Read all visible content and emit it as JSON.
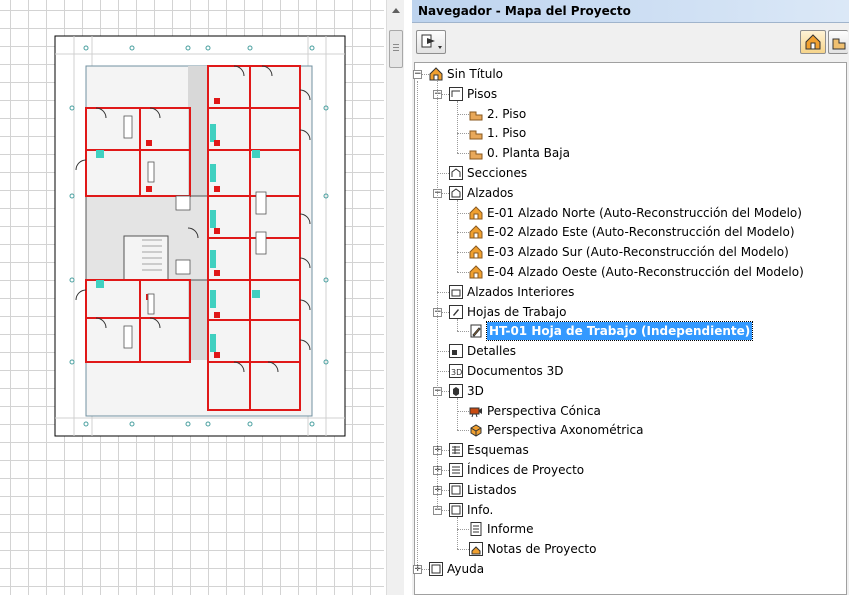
{
  "navigator": {
    "title": "Navegador - Mapa del Proyecto"
  },
  "tree": [
    {
      "id": "root",
      "label": "Sin Título",
      "level": 0,
      "expander": "-",
      "icon": "house-icon"
    },
    {
      "id": "pisos",
      "label": "Pisos",
      "level": 1,
      "expander": "-",
      "icon": "stories-icon"
    },
    {
      "id": "piso2",
      "label": "2. Piso",
      "level": 2,
      "icon": "story-icon"
    },
    {
      "id": "piso1",
      "label": "1. Piso",
      "level": 2,
      "icon": "story-icon"
    },
    {
      "id": "piso0",
      "label": "0. Planta Baja",
      "level": 2,
      "icon": "story-icon"
    },
    {
      "id": "secciones",
      "label": "Secciones",
      "level": 1,
      "icon": "section-icon"
    },
    {
      "id": "alzados",
      "label": "Alzados",
      "level": 1,
      "expander": "-",
      "icon": "elevation-icon"
    },
    {
      "id": "e01",
      "label": "E-01 Alzado Norte (Auto-Reconstrucción del Modelo)",
      "level": 2,
      "icon": "elevation-item-icon"
    },
    {
      "id": "e02",
      "label": "E-02 Alzado Este (Auto-Reconstrucción del Modelo)",
      "level": 2,
      "icon": "elevation-item-icon"
    },
    {
      "id": "e03",
      "label": "E-03 Alzado Sur (Auto-Reconstrucción del Modelo)",
      "level": 2,
      "icon": "elevation-item-icon"
    },
    {
      "id": "e04",
      "label": "E-04 Alzado Oeste (Auto-Reconstrucción del Modelo)",
      "level": 2,
      "icon": "elevation-item-icon"
    },
    {
      "id": "alzint",
      "label": "Alzados Interiores",
      "level": 1,
      "icon": "interior-elevation-icon"
    },
    {
      "id": "hojas",
      "label": "Hojas de Trabajo",
      "level": 1,
      "expander": "-",
      "icon": "worksheet-icon"
    },
    {
      "id": "ht01",
      "label": "HT-01 Hoja de Trabajo (Independiente)",
      "level": 2,
      "icon": "worksheet-item-icon",
      "selected": true
    },
    {
      "id": "detalles",
      "label": "Detalles",
      "level": 1,
      "icon": "detail-icon"
    },
    {
      "id": "doc3d",
      "label": "Documentos 3D",
      "level": 1,
      "icon": "document-3d-icon"
    },
    {
      "id": "threed",
      "label": "3D",
      "level": 1,
      "expander": "-",
      "icon": "3d-icon"
    },
    {
      "id": "perspcon",
      "label": "Perspectiva Cónica",
      "level": 2,
      "icon": "camera-icon"
    },
    {
      "id": "perspaxo",
      "label": "Perspectiva Axonométrica",
      "level": 2,
      "icon": "axonometric-icon"
    },
    {
      "id": "esquemas",
      "label": "Esquemas",
      "level": 1,
      "expander": "+",
      "icon": "schedule-icon"
    },
    {
      "id": "indices",
      "label": "Índices de Proyecto",
      "level": 1,
      "expander": "+",
      "icon": "index-icon"
    },
    {
      "id": "listados",
      "label": "Listados",
      "level": 1,
      "expander": "+",
      "icon": "list-icon"
    },
    {
      "id": "info",
      "label": "Info.",
      "level": 1,
      "expander": "-",
      "icon": "info-icon"
    },
    {
      "id": "informe",
      "label": "Informe",
      "level": 2,
      "icon": "report-icon"
    },
    {
      "id": "notas",
      "label": "Notas de Proyecto",
      "level": 2,
      "icon": "notes-icon"
    },
    {
      "id": "ayuda",
      "label": "Ayuda",
      "level": 0,
      "expander": "+",
      "icon": "help-icon"
    }
  ],
  "colors": {
    "wall": "#e01818",
    "glass": "#40d0c0",
    "selection": "#3399ff",
    "stair": "#d8d8d8"
  }
}
